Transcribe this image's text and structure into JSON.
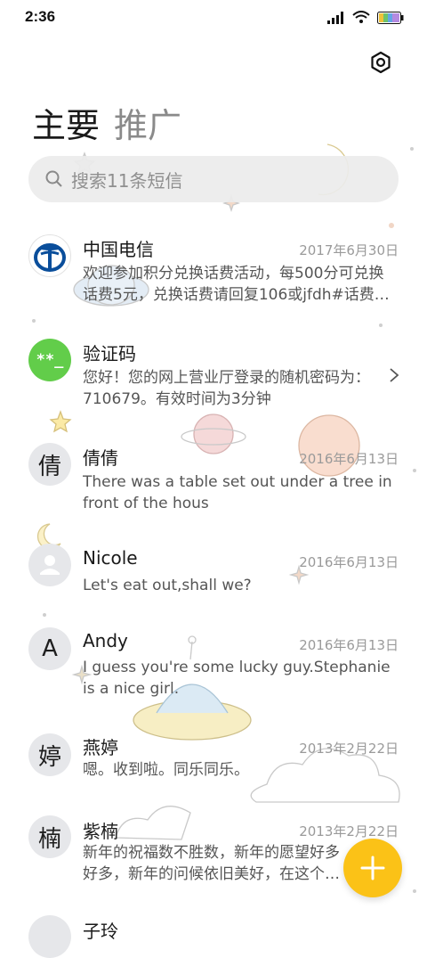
{
  "status_bar": {
    "time": "2:36"
  },
  "tabs": [
    {
      "label": "主要",
      "active": true
    },
    {
      "label": "推广",
      "active": false
    }
  ],
  "search": {
    "placeholder": "搜索11条短信"
  },
  "conversations": [
    {
      "name": "中国电信",
      "date": "2017年6月30日",
      "preview": "欢迎参加积分兑换话费活动，每500分可兑换话费5元，兑换话费请回复106或jfdh#话费…",
      "avatar": "telecom-logo"
    },
    {
      "name": "验证码",
      "date": "",
      "preview": "您好！您的网上营业厅登录的随机密码为：710679。有效时间为3分钟",
      "avatar_text": "**_"
    },
    {
      "name": "倩倩",
      "date": "2016年6月13日",
      "preview": "There was a table set out under a tree in front of the hous",
      "avatar_text": "倩"
    },
    {
      "name": "Nicole",
      "date": "2016年6月13日",
      "preview": "Let's eat out,shall we?",
      "avatar": "person-icon"
    },
    {
      "name": "Andy",
      "date": "2016年6月13日",
      "preview": "I guess you're some lucky guy.Stephanie is a nice girl.",
      "avatar_text": "A"
    },
    {
      "name": "燕婷",
      "date": "2013年2月22日",
      "preview": "嗯。收到啦。同乐同乐。",
      "avatar_text": "婷"
    },
    {
      "name": "紫楠",
      "date": "2013年2月22日",
      "preview": "新年的祝福数不胜数，新年的愿望好多好多，新年的问候依旧美好，在这个温馨的时刻",
      "avatar_text": "楠"
    },
    {
      "name": "子玲",
      "date": "",
      "preview": "",
      "avatar_text": ""
    }
  ],
  "colors": {
    "accent_fab": "#fbc217",
    "verification_avatar": "#62cd4a",
    "telecom_blue": "#0a4e9b"
  },
  "icons": {
    "settings": "settings-icon",
    "search": "search-icon",
    "fab": "plus-icon",
    "chevron": "chevron-right-icon"
  }
}
